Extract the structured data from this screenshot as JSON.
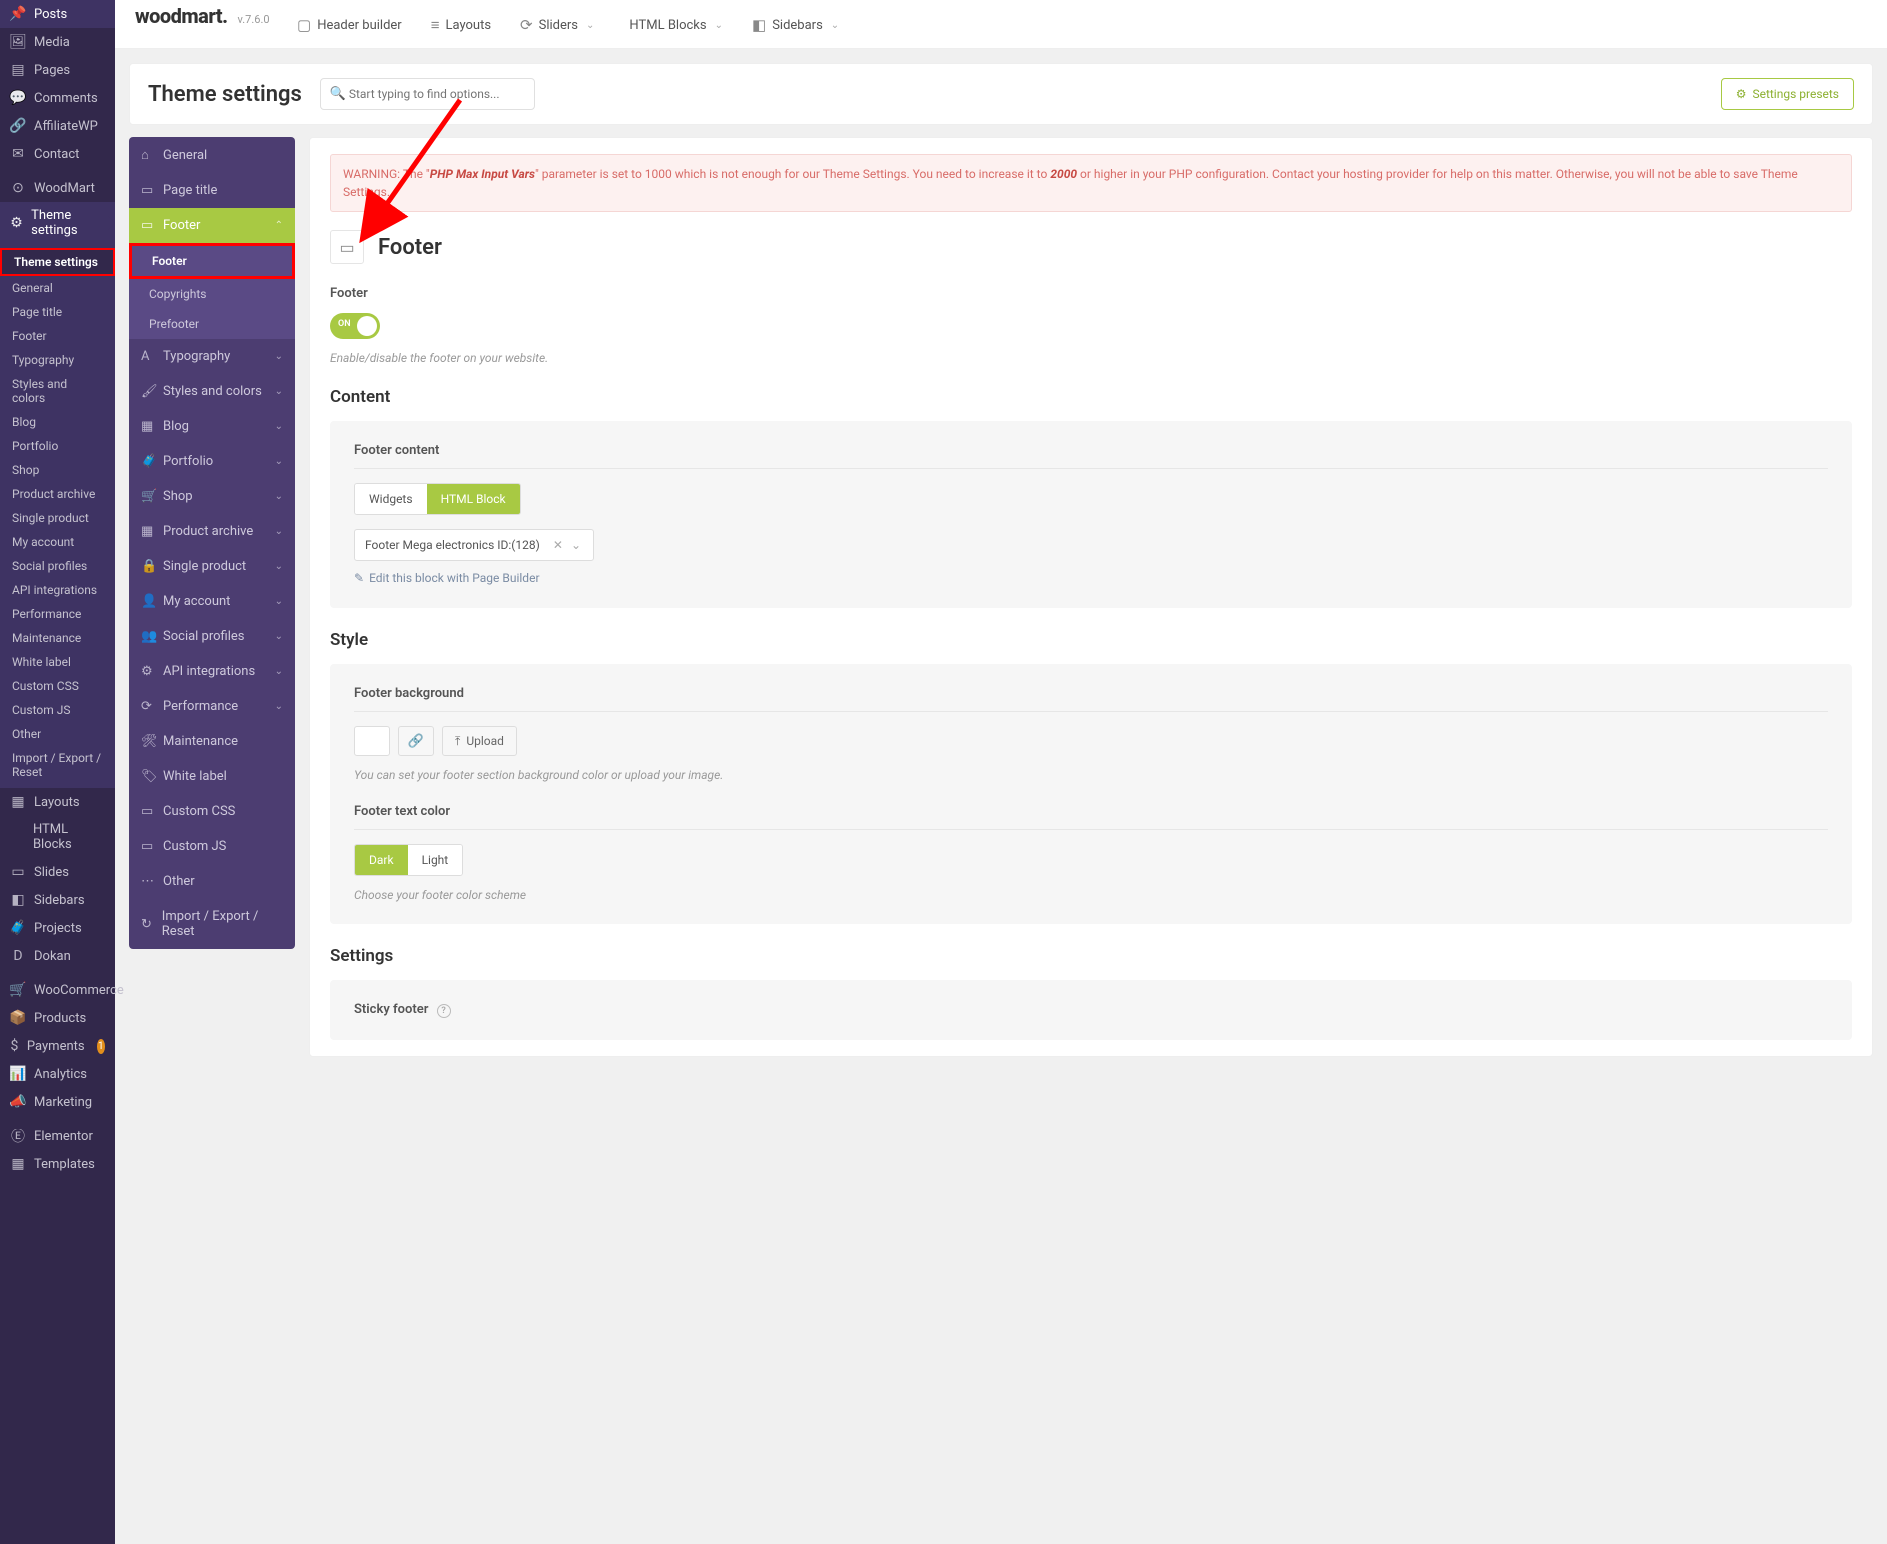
{
  "wp_sidebar": {
    "items": [
      {
        "icon": "📌",
        "label": "Posts"
      },
      {
        "icon": "🖼",
        "label": "Media"
      },
      {
        "icon": "▤",
        "label": "Pages"
      },
      {
        "icon": "💬",
        "label": "Comments"
      },
      {
        "icon": "🔗",
        "label": "AffiliateWP"
      },
      {
        "icon": "✉",
        "label": "Contact"
      }
    ],
    "items2": [
      {
        "icon": "⊙",
        "label": "WoodMart"
      },
      {
        "icon": "⚙",
        "label": "Theme settings",
        "active": true
      }
    ],
    "theme_sub": [
      "Theme settings",
      "General",
      "Page title",
      "Footer",
      "Typography",
      "Styles and colors",
      "Blog",
      "Portfolio",
      "Shop",
      "Product archive",
      "Single product",
      "My account",
      "Social profiles",
      "API integrations",
      "Performance",
      "Maintenance",
      "White label",
      "Custom CSS",
      "Custom JS",
      "Other",
      "Import / Export / Reset"
    ],
    "items3": [
      {
        "icon": "▦",
        "label": "Layouts"
      },
      {
        "icon": "</>",
        "label": "HTML Blocks"
      },
      {
        "icon": "▭",
        "label": "Slides"
      },
      {
        "icon": "◧",
        "label": "Sidebars"
      },
      {
        "icon": "🧳",
        "label": "Projects"
      },
      {
        "icon": "D",
        "label": "Dokan"
      }
    ],
    "items4": [
      {
        "icon": "🛒",
        "label": "WooCommerce"
      },
      {
        "icon": "📦",
        "label": "Products"
      },
      {
        "icon": "$",
        "label": "Payments",
        "badge": "1"
      },
      {
        "icon": "📊",
        "label": "Analytics"
      },
      {
        "icon": "📣",
        "label": "Marketing"
      }
    ],
    "items5": [
      {
        "icon": "Ⓔ",
        "label": "Elementor"
      },
      {
        "icon": "▦",
        "label": "Templates"
      }
    ]
  },
  "topbar": {
    "brand": "woodmart.",
    "version": "v.7.6.0",
    "tabs": [
      {
        "icon": "▢",
        "label": "Header builder"
      },
      {
        "icon": "≡",
        "label": "Layouts"
      },
      {
        "icon": "⟳",
        "label": "Sliders",
        "dd": true
      },
      {
        "icon": "</>",
        "label": "HTML Blocks",
        "dd": true
      },
      {
        "icon": "◧",
        "label": "Sidebars",
        "dd": true
      }
    ]
  },
  "header": {
    "title": "Theme settings",
    "search_placeholder": "Start typing to find options...",
    "presets_label": "Settings presets"
  },
  "settings_nav": [
    {
      "icon": "⌂",
      "label": "General"
    },
    {
      "icon": "▭",
      "label": "Page title"
    },
    {
      "icon": "▭",
      "label": "Footer",
      "active": true,
      "children": [
        "Footer",
        "Copyrights",
        "Prefooter"
      ],
      "child_active": 0
    },
    {
      "icon": "A",
      "label": "Typography",
      "dd": true
    },
    {
      "icon": "🖌",
      "label": "Styles and colors",
      "dd": true
    },
    {
      "icon": "▦",
      "label": "Blog",
      "dd": true
    },
    {
      "icon": "🧳",
      "label": "Portfolio",
      "dd": true
    },
    {
      "icon": "🛒",
      "label": "Shop",
      "dd": true
    },
    {
      "icon": "▦",
      "label": "Product archive",
      "dd": true
    },
    {
      "icon": "🔒",
      "label": "Single product",
      "dd": true
    },
    {
      "icon": "👤",
      "label": "My account",
      "dd": true
    },
    {
      "icon": "👥",
      "label": "Social profiles",
      "dd": true
    },
    {
      "icon": "⚙",
      "label": "API integrations",
      "dd": true
    },
    {
      "icon": "⟳",
      "label": "Performance",
      "dd": true
    },
    {
      "icon": "🛠",
      "label": "Maintenance"
    },
    {
      "icon": "🏷",
      "label": "White label"
    },
    {
      "icon": "▭",
      "label": "Custom CSS"
    },
    {
      "icon": "▭",
      "label": "Custom JS"
    },
    {
      "icon": "⋯",
      "label": "Other"
    },
    {
      "icon": "↻",
      "label": "Import / Export / Reset"
    }
  ],
  "panel": {
    "warning": {
      "pre": "WARNING: The \"",
      "b1": "PHP Max Input Vars",
      "mid": "\" parameter is set to 1000 which is not enough for our Theme Settings. You need to increase it to ",
      "b2": "2000",
      "post": " or higher in your PHP configuration. Contact your hosting provider for help on this matter. Otherwise, you will not be able to save Theme Settings."
    },
    "title": "Footer",
    "footer_section": {
      "label": "Footer",
      "toggle_on": "ON",
      "help": "Enable/disable the footer on your website."
    },
    "content": {
      "heading": "Content",
      "field": "Footer content",
      "seg1": "Widgets",
      "seg2": "HTML Block",
      "select_value": "Footer Mega electronics ID:(128)",
      "edit_link": "Edit this block with Page Builder"
    },
    "style": {
      "heading": "Style",
      "bg_field": "Footer background",
      "upload": "Upload",
      "bg_help": "You can set your footer section background color or upload your image.",
      "txt_field": "Footer text color",
      "seg_dark": "Dark",
      "seg_light": "Light",
      "txt_help": "Choose your footer color scheme"
    },
    "settings": {
      "heading": "Settings",
      "sticky": "Sticky footer"
    }
  }
}
